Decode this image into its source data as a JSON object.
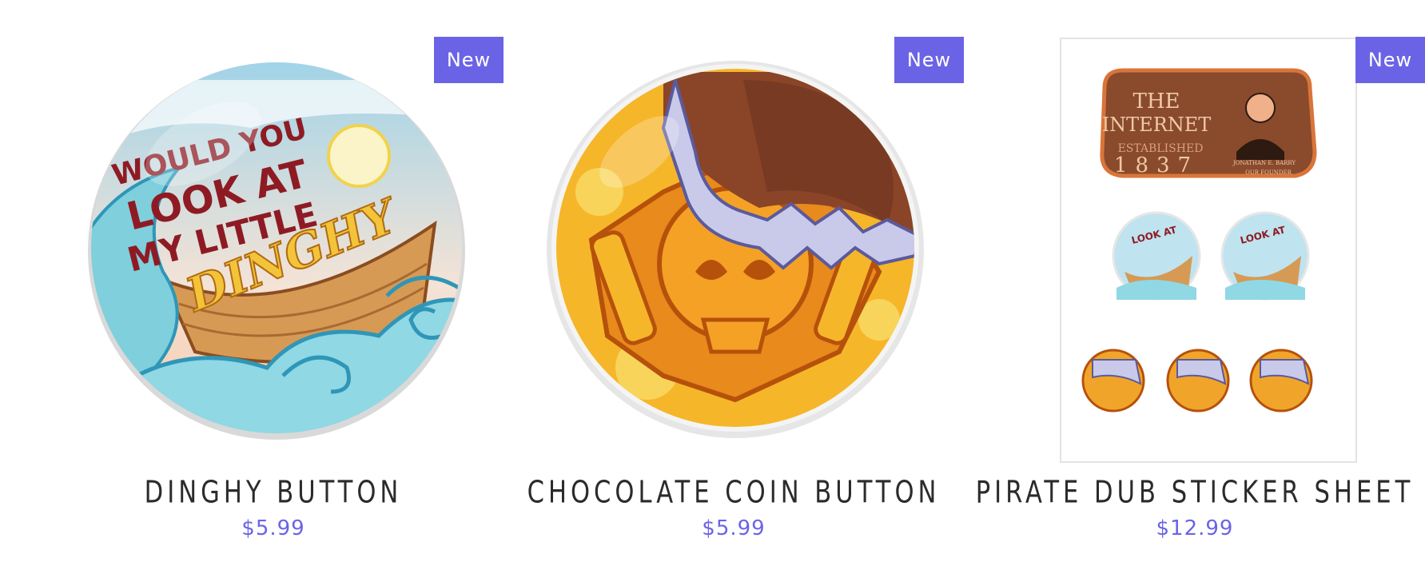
{
  "products": [
    {
      "badge": "New",
      "image_icon": "dinghy-button-image",
      "image_text": [
        "WOULD YOU",
        "LOOK AT",
        "MY LITTLE",
        "DINGHY"
      ],
      "title": "DINGHY BUTTON",
      "price": "$5.99"
    },
    {
      "badge": "New",
      "image_icon": "chocolate-coin-button-image",
      "title": "CHOCOLATE COIN BUTTON",
      "price": "$5.99"
    },
    {
      "badge": "New",
      "image_icon": "sticker-sheet-image",
      "sign_text": {
        "line1": "THE",
        "line2": "INTERNET",
        "line3": "ESTABLISHED",
        "year": "1837",
        "founder": "JONATHAN E. BARRY",
        "founder_title": "OUR FOUNDER"
      },
      "title": "PIRATE DUB STICKER SHEET",
      "price": "$12.99"
    }
  ],
  "colors": {
    "accent": "#6b63e6",
    "title": "#2b2b2b"
  }
}
